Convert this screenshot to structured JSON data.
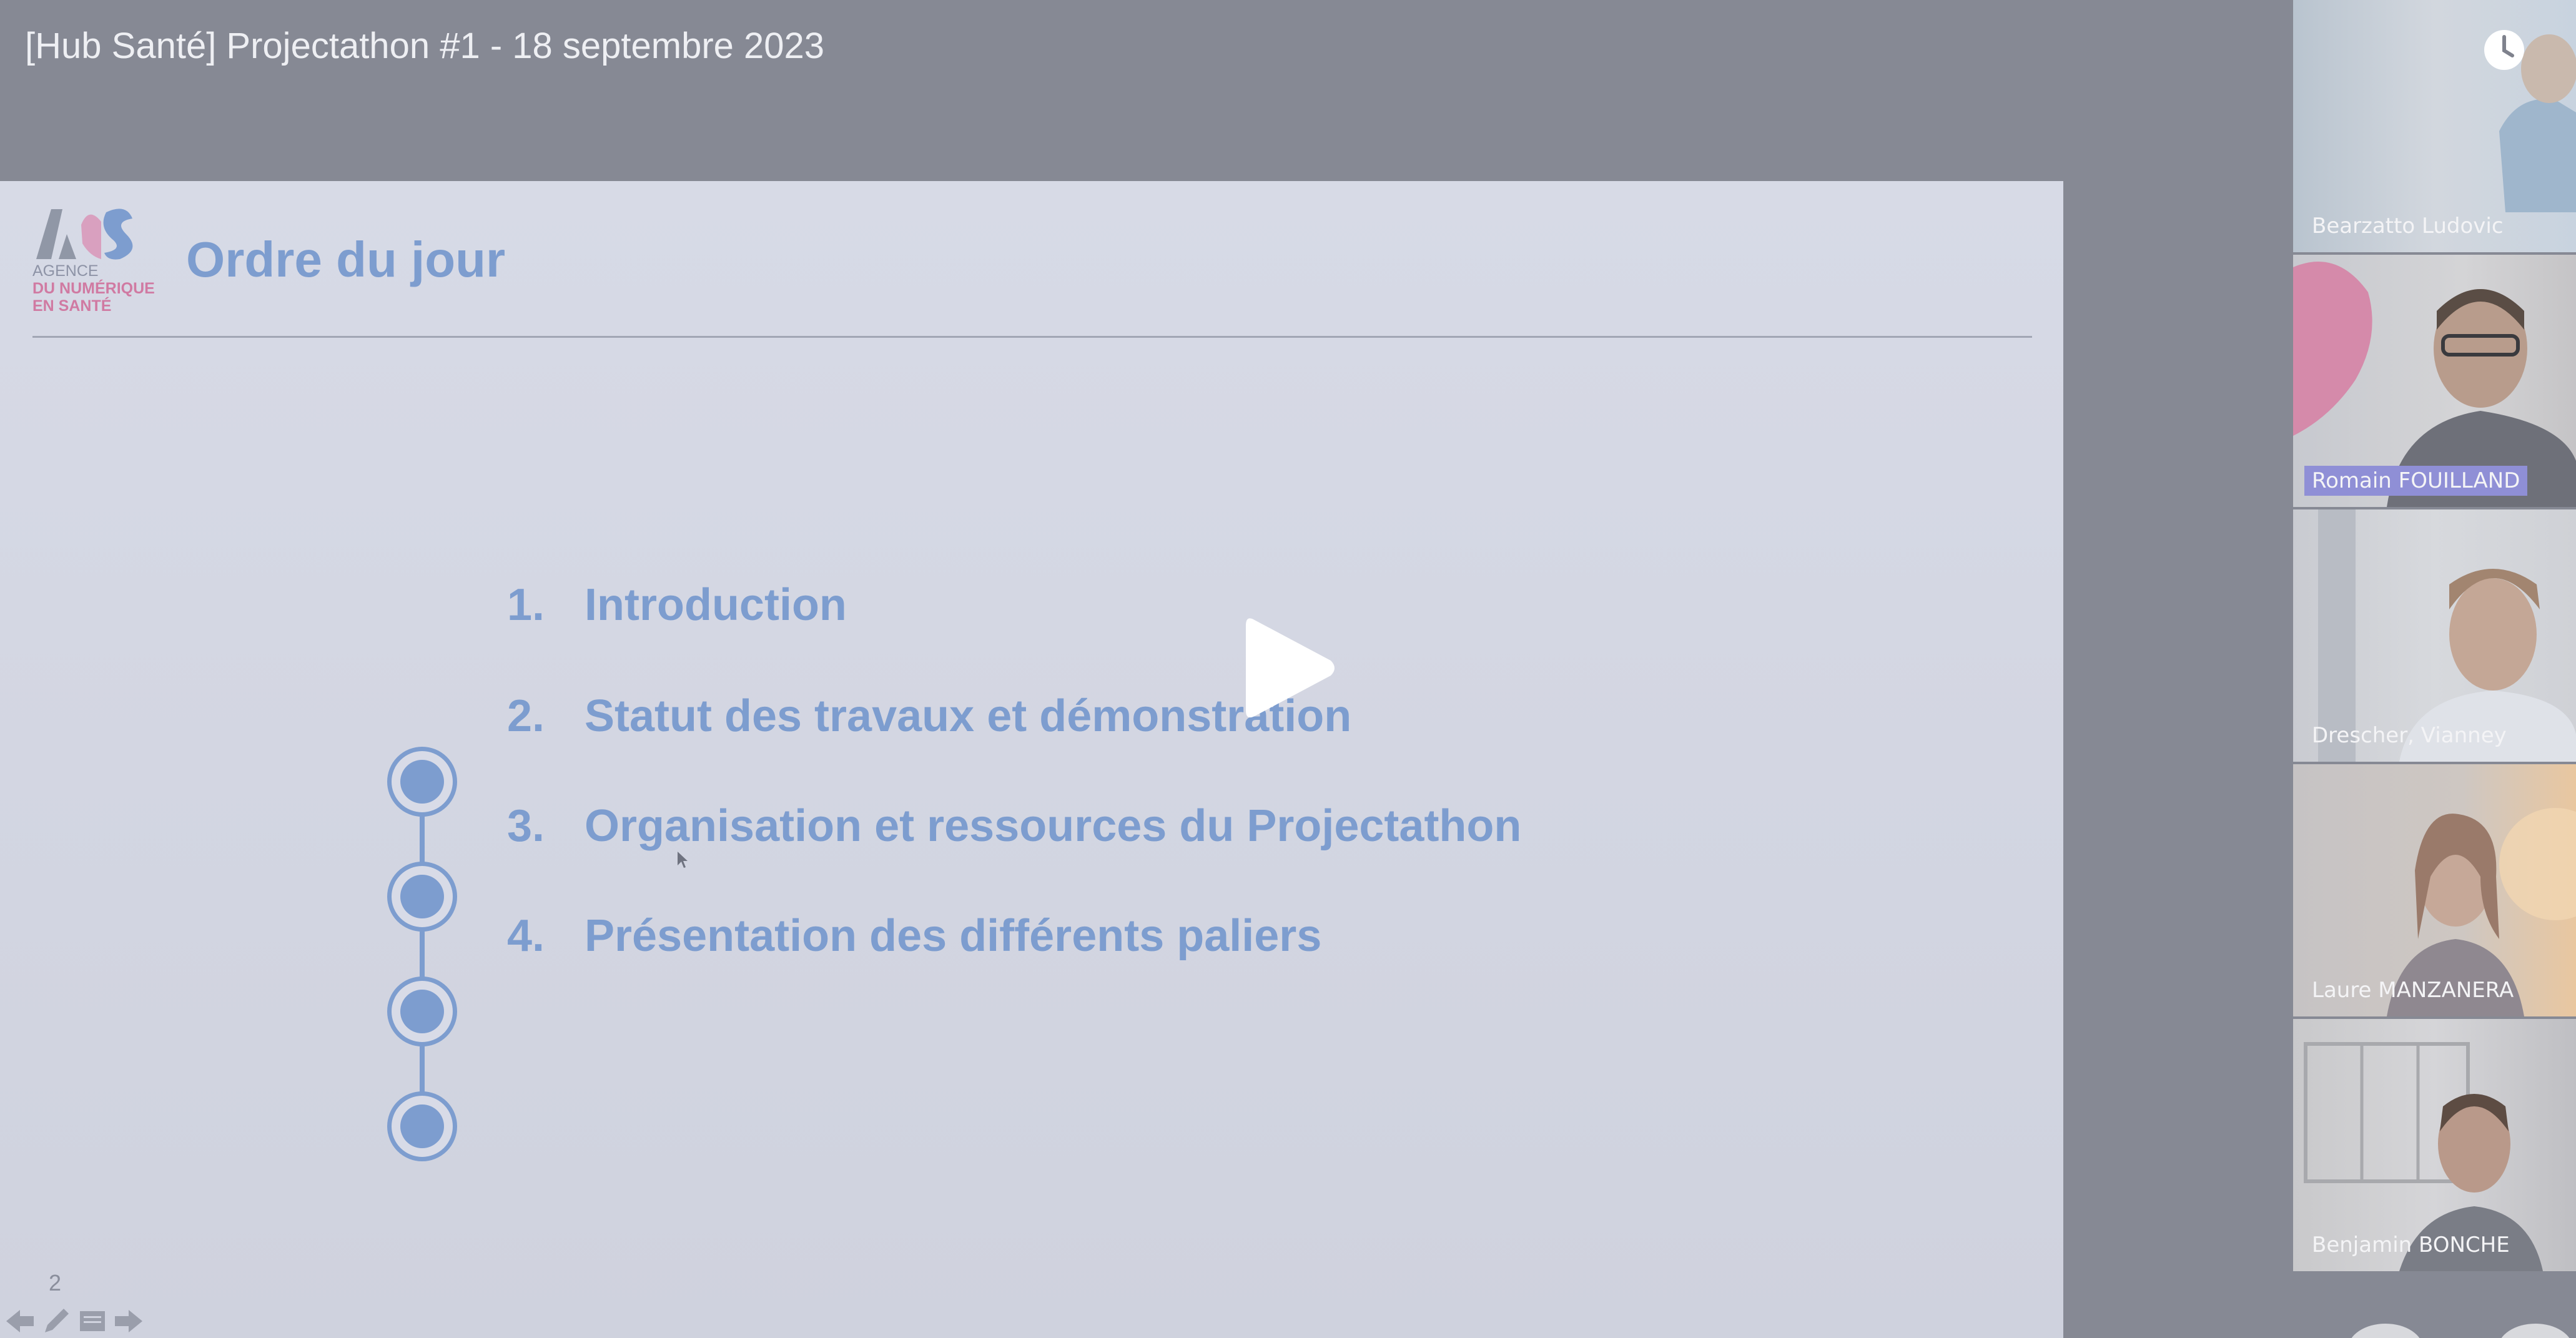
{
  "video": {
    "title": "[Hub Santé] Projectathon #1 - 18 septembre 2023"
  },
  "slide": {
    "logo": {
      "line1": "AGENCE",
      "line2": "DU NUMÉRIQUE",
      "line3": "EN SANTÉ"
    },
    "title": "Ordre du jour",
    "agenda": [
      {
        "number": "1.",
        "label": "Introduction"
      },
      {
        "number": "2.",
        "label": "Statut des travaux et démonstration"
      },
      {
        "number": "3.",
        "label": "Organisation et ressources du Projectathon"
      },
      {
        "number": "4.",
        "label": "Présentation des différents paliers"
      }
    ],
    "page_number": "2"
  },
  "participants": [
    {
      "name": "Bearzatto Ludovic",
      "active": false
    },
    {
      "name": "Romain FOUILLAND",
      "active": true
    },
    {
      "name": "Drescher, Vianney",
      "active": false
    },
    {
      "name": "Laure MANZANERA",
      "active": false
    },
    {
      "name": "Benjamin BONCHE",
      "active": false
    }
  ],
  "icons": {
    "play": "play-icon",
    "clock": "clock-icon",
    "prev": "arrow-left-icon",
    "pen": "pen-icon",
    "notes": "notes-icon",
    "next": "arrow-right-icon"
  },
  "colors": {
    "slide_accent": "#7d9dcf",
    "background": "#868994",
    "active_name": "#8f8fd6"
  }
}
